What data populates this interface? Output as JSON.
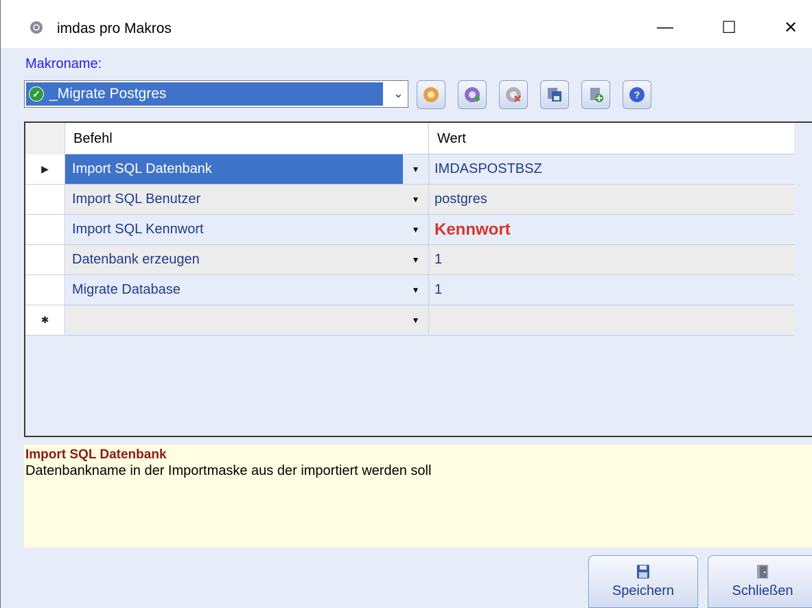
{
  "window": {
    "title": "imdas pro Makros",
    "controls": {
      "minimize": "—",
      "maximize": "☐",
      "close": "✕"
    }
  },
  "macro": {
    "label": "Makroname:",
    "selected": "_Migrate Postgres"
  },
  "toolbar": {
    "buttons": [
      {
        "icon": "gear-orange-icon",
        "color": "#e8a040"
      },
      {
        "icon": "gear-purple-icon",
        "color": "#8a6fc8"
      },
      {
        "icon": "gear-delete-icon",
        "color": "#c85a4a"
      },
      {
        "icon": "copy-save-icon",
        "color": "#3a5fa8"
      },
      {
        "icon": "add-document-icon",
        "color": "#4aa04a"
      },
      {
        "icon": "help-icon",
        "color": "#3b5fcf"
      }
    ]
  },
  "grid": {
    "columns": {
      "befehl": "Befehl",
      "wert": "Wert"
    },
    "rows": [
      {
        "indicator": "▶",
        "befehl": "Import SQL Datenbank",
        "wert": "IMDASPOSTBSZ"
      },
      {
        "indicator": "",
        "befehl": "Import SQL Benutzer",
        "wert": "postgres"
      },
      {
        "indicator": "",
        "befehl": "Import SQL Kennwort",
        "wert": "Kennwort"
      },
      {
        "indicator": "",
        "befehl": "Datenbank erzeugen",
        "wert": "1"
      },
      {
        "indicator": "",
        "befehl": "Migrate Database",
        "wert": "1"
      },
      {
        "indicator": "✱",
        "befehl": "",
        "wert": ""
      }
    ],
    "dropdown_glyph": "▾"
  },
  "description": {
    "title": "Import SQL Datenbank",
    "text": "Datenbankname in der Importmaske aus der importiert werden soll"
  },
  "footer": {
    "save_label": "Speichern",
    "close_label": "Schließen"
  },
  "colors": {
    "selection": "#3f73c9",
    "label_blue": "#2323e8",
    "kennwort_red": "#d7352b",
    "description_title": "#8b1a1a",
    "description_bg": "#fffde2"
  }
}
